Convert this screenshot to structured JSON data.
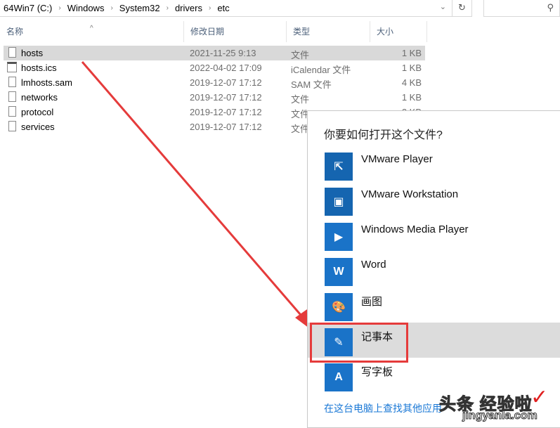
{
  "address": {
    "crumbs": [
      "64Win7 (C:)",
      "Windows",
      "System32",
      "drivers",
      "etc"
    ]
  },
  "columns": [
    "名称",
    "修改日期",
    "类型",
    "大小"
  ],
  "files": [
    {
      "name": "hosts",
      "date": "2021-11-25 9:13",
      "type": "文件",
      "size": "1 KB",
      "icon": "file-icon",
      "selected": true
    },
    {
      "name": "hosts.ics",
      "date": "2022-04-02 17:09",
      "type": "iCalendar 文件",
      "size": "1 KB",
      "icon": "calendar-icon"
    },
    {
      "name": "lmhosts.sam",
      "date": "2019-12-07 17:12",
      "type": "SAM 文件",
      "size": "4 KB",
      "icon": "file-icon"
    },
    {
      "name": "networks",
      "date": "2019-12-07 17:12",
      "type": "文件",
      "size": "1 KB",
      "icon": "file-icon"
    },
    {
      "name": "protocol",
      "date": "2019-12-07 17:12",
      "type": "文件",
      "size": "2 KB",
      "icon": "file-icon"
    },
    {
      "name": "services",
      "date": "2019-12-07 17:12",
      "type": "文件",
      "size": "",
      "icon": "file-icon"
    }
  ],
  "dialog": {
    "title": "你要如何打开这个文件?",
    "apps": [
      {
        "label": "VMware Player",
        "icon": "vmware-player-icon",
        "glyph": "⇱",
        "color": "#1565b0"
      },
      {
        "label": "VMware Workstation",
        "icon": "vmware-workstation-icon",
        "glyph": "▣",
        "color": "#1565b0"
      },
      {
        "label": "Windows Media Player",
        "icon": "media-player-icon",
        "glyph": "▶",
        "color": "#1a73c8"
      },
      {
        "label": "Word",
        "icon": "word-icon",
        "glyph": "W",
        "color": "#1a73c8"
      },
      {
        "label": "画图",
        "icon": "paint-icon",
        "glyph": "🎨",
        "color": "#1a73c8"
      },
      {
        "label": "记事本",
        "icon": "notepad-icon",
        "glyph": "✎",
        "color": "#1a73c8",
        "selected": true
      },
      {
        "label": "写字板",
        "icon": "wordpad-icon",
        "glyph": "A",
        "color": "#1a73c8"
      }
    ],
    "more_link": "在这台电脑上查找其他应用"
  },
  "watermark": {
    "line1": "头条 经验啦",
    "line2": "jingyanla.com"
  },
  "annotation_color": "#e53b3b"
}
